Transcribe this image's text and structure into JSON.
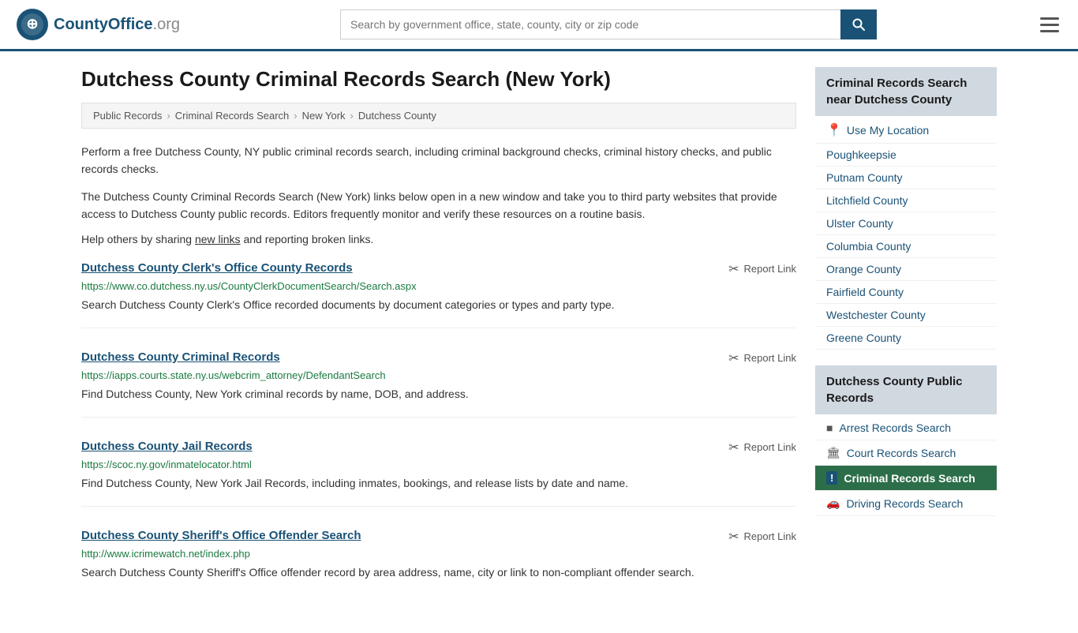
{
  "header": {
    "logo_text": "CountyOffice",
    "logo_org": ".org",
    "search_placeholder": "Search by government office, state, county, city or zip code",
    "search_icon": "🔍"
  },
  "page": {
    "title": "Dutchess County Criminal Records Search (New York)",
    "breadcrumb": [
      "Public Records",
      "Criminal Records Search",
      "New York",
      "Dutchess County"
    ],
    "desc1": "Perform a free Dutchess County, NY public criminal records search, including criminal background checks, criminal history checks, and public records checks.",
    "desc2": "The Dutchess County Criminal Records Search (New York) links below open in a new window and take you to third party websites that provide access to Dutchess County public records. Editors frequently monitor and verify these resources on a routine basis.",
    "help_prefix": "Help others by sharing ",
    "new_links": "new links",
    "help_suffix": " and reporting broken links."
  },
  "records": [
    {
      "title": "Dutchess County Clerk's Office County Records",
      "url": "https://www.co.dutchess.ny.us/CountyClerkDocumentSearch/Search.aspx",
      "desc": "Search Dutchess County Clerk's Office recorded documents by document categories or types and party type.",
      "report_label": "Report Link"
    },
    {
      "title": "Dutchess County Criminal Records",
      "url": "https://iapps.courts.state.ny.us/webcrim_attorney/DefendantSearch",
      "desc": "Find Dutchess County, New York criminal records by name, DOB, and address.",
      "report_label": "Report Link"
    },
    {
      "title": "Dutchess County Jail Records",
      "url": "https://scoc.ny.gov/inmatelocator.html",
      "desc": "Find Dutchess County, New York Jail Records, including inmates, bookings, and release lists by date and name.",
      "report_label": "Report Link"
    },
    {
      "title": "Dutchess County Sheriff's Office Offender Search",
      "url": "http://www.icrimewatch.net/index.php",
      "desc": "Search Dutchess County Sheriff's Office offender record by area address, name, city or link to non-compliant offender search.",
      "report_label": "Report Link"
    }
  ],
  "sidebar": {
    "nearby_header": "Criminal Records Search near Dutchess County",
    "nearby_links": [
      {
        "label": "Use My Location",
        "use_location": true
      },
      {
        "label": "Poughkeepsie"
      },
      {
        "label": "Putnam County"
      },
      {
        "label": "Litchfield County"
      },
      {
        "label": "Ulster County"
      },
      {
        "label": "Columbia County"
      },
      {
        "label": "Orange County"
      },
      {
        "label": "Fairfield County"
      },
      {
        "label": "Westchester County"
      },
      {
        "label": "Greene County"
      }
    ],
    "public_records_header": "Dutchess County Public Records",
    "public_records_links": [
      {
        "label": "Arrest Records Search",
        "icon": "■",
        "active": false
      },
      {
        "label": "Court Records Search",
        "icon": "🏛",
        "active": false
      },
      {
        "label": "Criminal Records Search",
        "icon": "!",
        "active": true
      },
      {
        "label": "Driving Records Search",
        "icon": "🚗",
        "active": false
      }
    ]
  }
}
